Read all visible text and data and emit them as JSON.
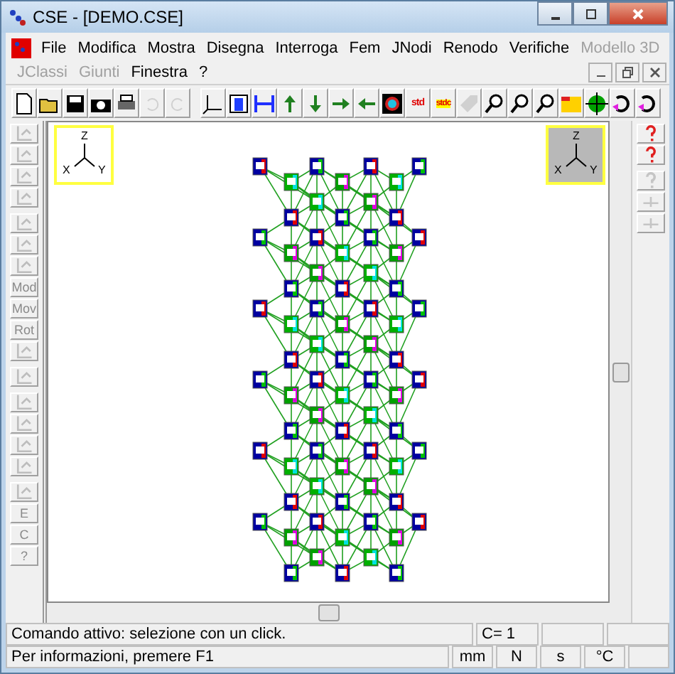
{
  "window": {
    "title": "CSE - [DEMO.CSE]"
  },
  "menu_rows": [
    [
      {
        "label": "File",
        "disabled": false
      },
      {
        "label": "Modifica",
        "disabled": false
      },
      {
        "label": "Mostra",
        "disabled": false
      },
      {
        "label": "Disegna",
        "disabled": false
      },
      {
        "label": "Interroga",
        "disabled": false
      },
      {
        "label": "Fem",
        "disabled": false
      },
      {
        "label": "JNodi",
        "disabled": false
      },
      {
        "label": "Renodo",
        "disabled": false
      },
      {
        "label": "Verifiche",
        "disabled": false
      },
      {
        "label": "Modello 3D",
        "disabled": true
      }
    ],
    [
      {
        "label": "JClassi",
        "disabled": true
      },
      {
        "label": "Giunti",
        "disabled": true
      },
      {
        "label": "Finestra",
        "disabled": false
      },
      {
        "label": "?",
        "disabled": false
      }
    ]
  ],
  "toolbar": [
    {
      "kind": "new",
      "disabled": false
    },
    {
      "kind": "open",
      "disabled": false
    },
    {
      "kind": "save",
      "disabled": false
    },
    {
      "kind": "camera",
      "disabled": false
    },
    {
      "kind": "print",
      "disabled": false
    },
    {
      "kind": "undo",
      "disabled": true
    },
    {
      "kind": "redo",
      "disabled": true
    },
    {
      "kind": "sep"
    },
    {
      "kind": "axes",
      "disabled": false
    },
    {
      "kind": "frame",
      "disabled": false
    },
    {
      "kind": "width",
      "disabled": false
    },
    {
      "kind": "up",
      "disabled": false
    },
    {
      "kind": "down",
      "disabled": false
    },
    {
      "kind": "right",
      "disabled": false
    },
    {
      "kind": "left",
      "disabled": false
    },
    {
      "kind": "fit",
      "disabled": false
    },
    {
      "kind": "flag",
      "label": "std",
      "disabled": false
    },
    {
      "kind": "flag",
      "label": "stdc",
      "disabled": false
    },
    {
      "kind": "tag",
      "disabled": true
    },
    {
      "kind": "zoom",
      "disabled": false
    },
    {
      "kind": "zoom",
      "disabled": false
    },
    {
      "kind": "zoom",
      "disabled": false
    },
    {
      "kind": "folder",
      "disabled": false
    },
    {
      "kind": "globe",
      "disabled": false
    },
    {
      "kind": "rotate",
      "disabled": false
    },
    {
      "kind": "rotate",
      "disabled": false
    }
  ],
  "left_tools": [
    {
      "kind": "icon",
      "disabled": true
    },
    {
      "kind": "icon",
      "disabled": true
    },
    {
      "kind": "icon",
      "disabled": true
    },
    {
      "kind": "icon",
      "disabled": true
    },
    {
      "kind": "sep"
    },
    {
      "kind": "icon",
      "disabled": true
    },
    {
      "kind": "icon",
      "disabled": true
    },
    {
      "kind": "icon",
      "disabled": true
    },
    {
      "kind": "text",
      "label": "Mod",
      "disabled": true
    },
    {
      "kind": "text",
      "label": "Mov",
      "disabled": true
    },
    {
      "kind": "text",
      "label": "Rot",
      "disabled": true
    },
    {
      "kind": "icon",
      "disabled": true
    },
    {
      "kind": "sep"
    },
    {
      "kind": "icon",
      "disabled": true
    },
    {
      "kind": "sep"
    },
    {
      "kind": "icon",
      "disabled": true
    },
    {
      "kind": "icon",
      "disabled": true
    },
    {
      "kind": "icon",
      "disabled": true
    },
    {
      "kind": "icon",
      "disabled": true
    },
    {
      "kind": "sep"
    },
    {
      "kind": "icon",
      "disabled": true
    },
    {
      "kind": "text",
      "label": "E",
      "disabled": true
    },
    {
      "kind": "text",
      "label": "C",
      "disabled": true
    },
    {
      "kind": "text",
      "label": "?",
      "disabled": true
    }
  ],
  "right_tools": [
    {
      "kind": "help",
      "disabled": false
    },
    {
      "kind": "help",
      "disabled": false
    },
    {
      "kind": "sep"
    },
    {
      "kind": "help",
      "disabled": true
    },
    {
      "kind": "icon",
      "disabled": true
    },
    {
      "kind": "icon",
      "disabled": true
    }
  ],
  "axes": [
    {
      "labels": [
        "Z",
        "X",
        "Y"
      ],
      "shaded": false
    },
    {
      "labels": [
        "Z",
        "X",
        "Y"
      ],
      "shaded": true
    }
  ],
  "status": {
    "command": "Comando attivo: selezione con un click.",
    "count": "C=  1",
    "info": "Per informazioni, premere F1",
    "units": [
      "mm",
      "N",
      "s",
      "°C"
    ]
  }
}
